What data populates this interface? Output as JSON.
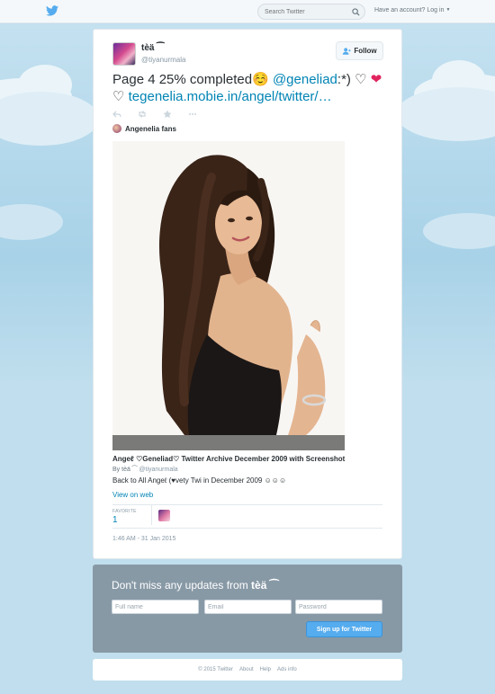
{
  "topbar": {
    "search_placeholder": "Search Twitter",
    "account_prompt": "Have an account?",
    "login_label": "Log in"
  },
  "tweet": {
    "author_name": "tèä ⁀",
    "author_handle": "@tiyanurmala",
    "follow_label": "Follow",
    "text_start": "Page 4 25% completed☺️ ",
    "mention": "@geneliad",
    "text_mid": ":*) ♡ ",
    "heart": "❤",
    "text_end": "♡ ",
    "url": "tegenelia.mobie.in/angel/twitter/…",
    "context_label": "Angenelia fans",
    "timestamp": "1:46 AM - 31 Jan 2015",
    "favorite_label": "FAVORITE",
    "favorite_count": "1"
  },
  "card": {
    "title": "Angeℓ ♡Geneliad♡ Twitter Archive December 2009 with Screenshot",
    "by_prefix": "By",
    "by_name": "tèä ⁀",
    "by_handle": "@tiyanurmala",
    "description": "Back to All Angeℓ (♥vety Twi in December 2009 ☺☺☺",
    "view_on_web": "View on web"
  },
  "signup": {
    "title_prefix": "Don't miss any updates from ",
    "title_name": "tèä ⁀",
    "fullname_placeholder": "Full name",
    "email_placeholder": "Email",
    "password_placeholder": "Password",
    "button_label": "Sign up for Twitter"
  },
  "footer": {
    "copyright": "© 2015 Twitter",
    "about": "About",
    "help": "Help",
    "ads_info": "Ads info"
  },
  "colors": {
    "link": "#0084b4",
    "button_blue": "#55acee",
    "panel_gray": "#8899a6",
    "sky": "#c0deed"
  }
}
